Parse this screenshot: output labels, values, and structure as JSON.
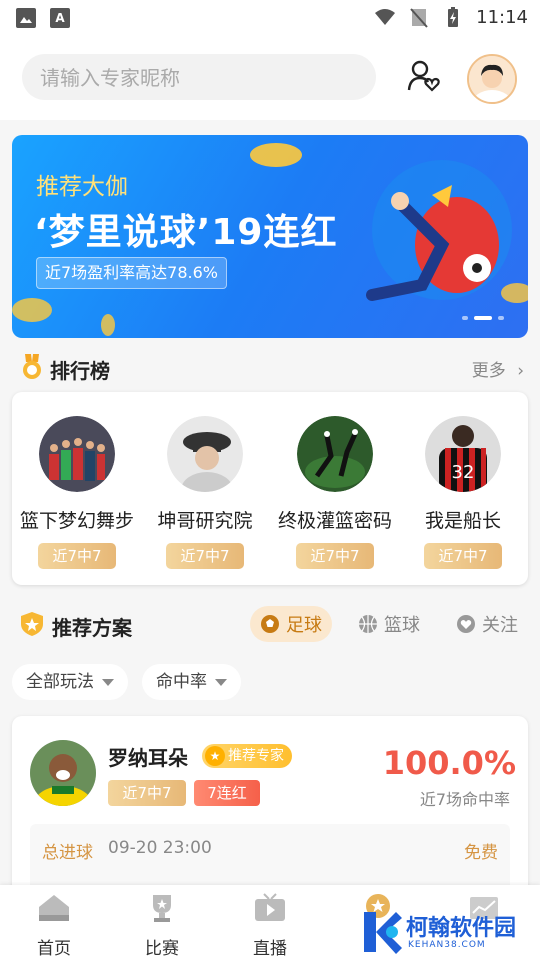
{
  "status_bar": {
    "time": "11:14"
  },
  "header": {
    "search_placeholder": "请输入专家昵称"
  },
  "banner": {
    "subtitle": "推荐大伽",
    "title": "‘梦里说球’19连红",
    "badge": "近7场盈利率高达78.6%"
  },
  "ranking": {
    "title": "排行榜",
    "more": "更多",
    "items": [
      {
        "name": "篮下梦幻舞步",
        "tag": "近7中7"
      },
      {
        "name": "坤哥研究院",
        "tag": "近7中7"
      },
      {
        "name": "终极灌篮密码",
        "tag": "近7中7"
      },
      {
        "name": "我是船长",
        "tag": "近7中7"
      }
    ]
  },
  "recommend": {
    "title": "推荐方案",
    "tabs": [
      "足球",
      "篮球",
      "关注"
    ],
    "active_tab": "足球",
    "filters": [
      "全部玩法",
      "命中率"
    ]
  },
  "plan": {
    "name": "罗纳耳朵",
    "badge": "推荐专家",
    "tag1": "近7中7",
    "tag2": "7连红",
    "rate": "100.0%",
    "rate_label": "近7场命中率",
    "type": "总进球",
    "time": "09-20 23:00",
    "price": "免费"
  },
  "bottom_nav": [
    "首页",
    "比赛",
    "直播",
    "",
    ""
  ],
  "watermark": {
    "text": "柯翰软件园",
    "sub": "KEHAN38.COM"
  },
  "colors": {
    "accent": "#f05a4a",
    "gold": "#e7b877",
    "banner_blue": "#1c7cf5"
  }
}
